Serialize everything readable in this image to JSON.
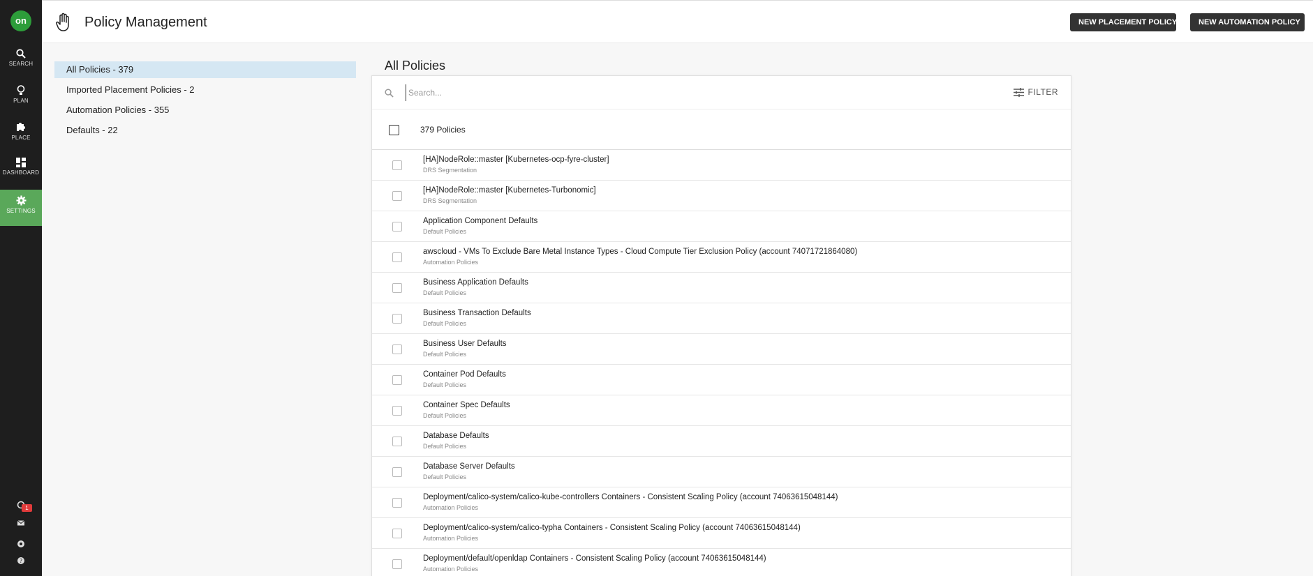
{
  "nav": {
    "logo": "on",
    "items": [
      {
        "label": "SEARCH",
        "icon": "search-icon"
      },
      {
        "label": "PLAN",
        "icon": "lightbulb-icon"
      },
      {
        "label": "PLACE",
        "icon": "puzzle-icon"
      },
      {
        "label": "DASHBOARD",
        "icon": "dashboard-icon"
      },
      {
        "label": "SETTINGS",
        "icon": "gear-icon",
        "active": true
      }
    ],
    "notification_count": "1",
    "active_color": "#5aa85a"
  },
  "header": {
    "title": "Policy Management",
    "btn_placement": "NEW PLACEMENT POLICY",
    "btn_automation": "NEW AUTOMATION POLICY"
  },
  "categories": [
    {
      "label": "All Policies - 379",
      "selected": true
    },
    {
      "label": "Imported Placement Policies - 2"
    },
    {
      "label": "Automation Policies - 355"
    },
    {
      "label": "Defaults - 22"
    }
  ],
  "main": {
    "title": "All Policies",
    "search_placeholder": "Search...",
    "filter_label": "FILTER",
    "count_label": "379 Policies",
    "rows": [
      {
        "name": "[HA]NodeRole::master [Kubernetes-ocp-fyre-cluster]",
        "type": "DRS Segmentation"
      },
      {
        "name": "[HA]NodeRole::master [Kubernetes-Turbonomic]",
        "type": "DRS Segmentation"
      },
      {
        "name": "Application Component Defaults",
        "type": "Default Policies"
      },
      {
        "name": "awscloud - VMs To Exclude Bare Metal Instance Types - Cloud Compute Tier Exclusion Policy (account 74071721864080)",
        "type": "Automation Policies"
      },
      {
        "name": "Business Application Defaults",
        "type": "Default Policies"
      },
      {
        "name": "Business Transaction Defaults",
        "type": "Default Policies"
      },
      {
        "name": "Business User Defaults",
        "type": "Default Policies"
      },
      {
        "name": "Container Pod Defaults",
        "type": "Default Policies"
      },
      {
        "name": "Container Spec Defaults",
        "type": "Default Policies"
      },
      {
        "name": "Database Defaults",
        "type": "Default Policies"
      },
      {
        "name": "Database Server Defaults",
        "type": "Default Policies"
      },
      {
        "name": "Deployment/calico-system/calico-kube-controllers Containers - Consistent Scaling Policy (account 74063615048144)",
        "type": "Automation Policies"
      },
      {
        "name": "Deployment/calico-system/calico-typha Containers - Consistent Scaling Policy (account 74063615048144)",
        "type": "Automation Policies"
      },
      {
        "name": "Deployment/default/openldap Containers - Consistent Scaling Policy (account 74063615048144)",
        "type": "Automation Policies"
      }
    ]
  }
}
